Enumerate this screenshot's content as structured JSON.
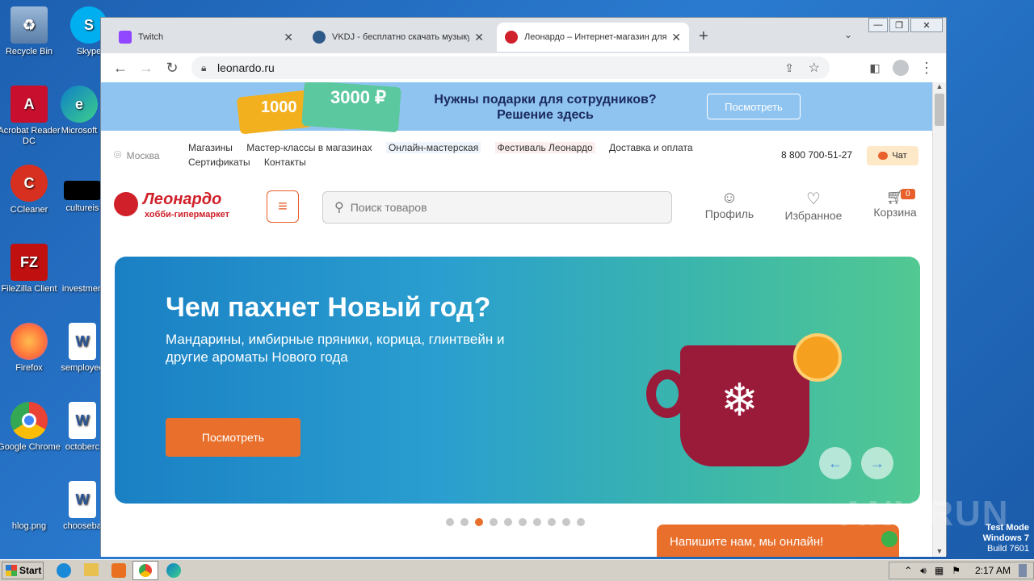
{
  "desktop_icons": [
    {
      "label": "Recycle Bin",
      "icon": "recycle-bin-icon",
      "color": "#5a7ea8"
    },
    {
      "label": "Skype",
      "icon": "skype-icon",
      "color": "#00aff0"
    },
    {
      "label": "Acrobat Reader DC",
      "icon": "acrobat-icon",
      "color": "#c8102e"
    },
    {
      "label": "Microsoft",
      "icon": "edge-icon",
      "color": "#0f7fc8"
    },
    {
      "label": "CCleaner",
      "icon": "ccleaner-icon",
      "color": "#d83020"
    },
    {
      "label": "cultureis",
      "icon": "file-icon",
      "color": "#000000"
    },
    {
      "label": "FileZilla Client",
      "icon": "filezilla-icon",
      "color": "#c01010"
    },
    {
      "label": "investmen",
      "icon": "file-icon",
      "color": "#2a7bd0"
    },
    {
      "label": "Firefox",
      "icon": "firefox-icon",
      "color": "#ff7139"
    },
    {
      "label": "semployee",
      "icon": "word-doc-icon",
      "color": "#ffffff"
    },
    {
      "label": "Google Chrome",
      "icon": "chrome-icon",
      "color": "#4285f4"
    },
    {
      "label": "octoberc",
      "icon": "word-doc-icon",
      "color": "#ffffff"
    },
    {
      "label": "hlog.png",
      "icon": "image-file-icon",
      "color": "#2a7bd0"
    },
    {
      "label": "chooseba",
      "icon": "word-doc-icon",
      "color": "#ffffff"
    }
  ],
  "tabs": [
    {
      "title": "Twitch",
      "fav_color": "#9146ff"
    },
    {
      "title": "VKDJ - бесплатно скачать музыку",
      "fav_color": "#2e5a8a"
    },
    {
      "title": "Леонардо – Интернет-магазин для",
      "fav_color": "#d0202a"
    }
  ],
  "url": "leonardo.ru",
  "banner": {
    "amount1": "1000",
    "amount2": "3000 ₽",
    "line1": "Нужны подарки для сотрудников?",
    "line2": "Решение здесь",
    "button": "Посмотреть"
  },
  "city": "Москва",
  "nav_row1": [
    "Магазины",
    "Мастер-классы в магазинах",
    "Онлайн-мастерская",
    "Фестиваль Леонардо",
    "Доставка и оплата"
  ],
  "nav_row2": [
    "Сертификаты",
    "Контакты"
  ],
  "phone": "8 800 700-51-27",
  "chat": "Чат",
  "logo": {
    "name": "Леонардо",
    "tag": "хобби-гипермаркет"
  },
  "search_placeholder": "Поиск товаров",
  "profile": "Профиль",
  "favorites": "Избранное",
  "cart": "Корзина",
  "cart_count": "0",
  "hero": {
    "title": "Чем пахнет Новый год?",
    "subtitle": "Мандарины, имбирные пряники, корица, глинтвейн и другие ароматы Нового года",
    "button": "Посмотреть"
  },
  "slides_total": 10,
  "slide_active": 3,
  "online_chat": "Напишите нам, мы онлайн!",
  "watermark": "ANY.RUN",
  "test_mode": [
    "Test Mode",
    "Windows 7",
    "Build 7601"
  ],
  "taskbar": {
    "start": "Start",
    "time": "2:17 AM"
  }
}
